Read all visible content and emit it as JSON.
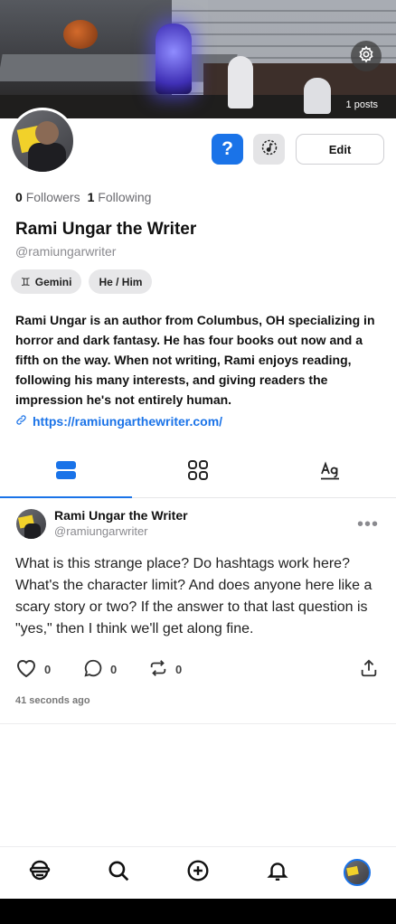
{
  "header": {
    "posts_count": "1 posts"
  },
  "profile": {
    "followers_count": "0",
    "followers_label": "Followers",
    "following_count": "1",
    "following_label": "Following",
    "name": "Rami Ungar the Writer",
    "handle": "@ramiungarwriter",
    "chips": [
      {
        "icon": "♊",
        "label": "Gemini"
      },
      {
        "label": "He / Him"
      }
    ],
    "bio": "Rami Ungar is an author from Columbus, OH specializing in horror and dark fantasy. He has four books out now and a fifth on the way. When not writing, Rami enjoys reading, following his many interests, and giving readers the impression he's not entirely human.",
    "link": "https://ramiungarthewriter.com/",
    "buttons": {
      "help": "?",
      "edit": "Edit"
    }
  },
  "tabs": [
    {
      "icon": "list-view-icon",
      "active": true
    },
    {
      "icon": "grid-view-icon",
      "active": false
    },
    {
      "icon": "text-view-icon",
      "active": false
    }
  ],
  "post": {
    "author_name": "Rami Ungar the Writer",
    "author_handle": "@ramiungarwriter",
    "text": "What is this strange place? Do hashtags work here? What's the character limit? And does anyone here like a scary story or two? If the answer to that last question is \"yes,\" then I think we'll get along fine.",
    "likes": "0",
    "comments": "0",
    "reposts": "0",
    "timestamp": "41 seconds ago",
    "more": "•••"
  },
  "colors": {
    "accent": "#1a73e8"
  }
}
